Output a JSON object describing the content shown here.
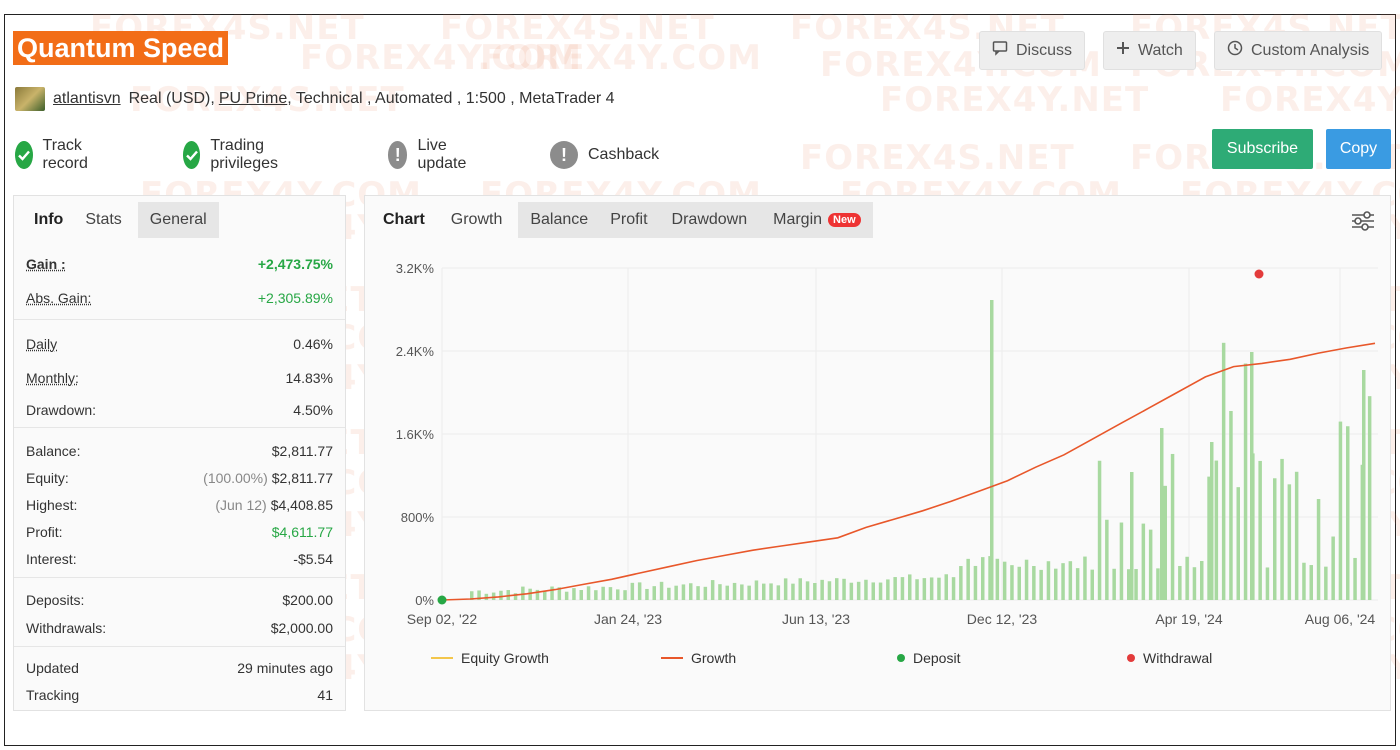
{
  "header": {
    "title": "Quantum Speed",
    "buttons": [
      {
        "label": "Discuss",
        "icon": "chat-icon"
      },
      {
        "label": "Watch",
        "icon": "plus-icon"
      },
      {
        "label": "Custom Analysis",
        "icon": "clock-icon"
      }
    ]
  },
  "meta": {
    "user": "atlantisvn",
    "account_type": "Real (USD),",
    "broker": "PU Prime",
    "details": ", Technical , Automated , 1:500 , MetaTrader 4"
  },
  "badges": [
    {
      "label": "Track record",
      "status": "ok"
    },
    {
      "label": "Trading privileges",
      "status": "ok"
    },
    {
      "label": "Live update",
      "status": "warn"
    },
    {
      "label": "Cashback",
      "status": "warn"
    }
  ],
  "actions": {
    "subscribe": "Subscribe",
    "copy": "Copy"
  },
  "left_tabs": [
    "Info",
    "Stats",
    "General"
  ],
  "stats": {
    "gain_label": "Gain :",
    "gain": "+2,473.75%",
    "abs_gain_label": "Abs. Gain:",
    "abs_gain": "+2,305.89%",
    "daily_label": "Daily",
    "daily": "0.46%",
    "monthly_label": "Monthly:",
    "monthly": "14.83%",
    "drawdown_label": "Drawdown:",
    "drawdown": "4.50%",
    "balance_label": "Balance:",
    "balance": "$2,811.77",
    "equity_label": "Equity:",
    "equity_note": "(100.00%)",
    "equity": "$2,811.77",
    "highest_label": "Highest:",
    "highest_note": "(Jun 12)",
    "highest": "$4,408.85",
    "profit_label": "Profit:",
    "profit": "$4,611.77",
    "interest_label": "Interest:",
    "interest": "-$5.54",
    "deposits_label": "Deposits:",
    "deposits": "$200.00",
    "withdrawals_label": "Withdrawals:",
    "withdrawals": "$2,000.00",
    "updated_label": "Updated",
    "updated": "29 minutes ago",
    "tracking_label": "Tracking",
    "tracking": "41"
  },
  "chart_tabs": {
    "title": "Chart",
    "items": [
      "Growth",
      "Balance",
      "Profit",
      "Drawdown",
      "Margin"
    ],
    "new_badge": "New"
  },
  "watermarks": [
    "FOREX4S.NET",
    "FOREX4Y.COM",
    "FOREX4Y.NET"
  ],
  "colors": {
    "accent": "#f26d17",
    "green": "#27a745",
    "growth": "#e8572a",
    "equity": "#f3c64b",
    "bars": "#a8d9a0",
    "withdrawal": "#e33b3b"
  },
  "chart_data": {
    "type": "line",
    "y_ticks": [
      "0%",
      "800%",
      "1.6K%",
      "2.4K%",
      "3.2K%"
    ],
    "ylim": [
      0,
      3200
    ],
    "x_ticks": [
      "Sep 02, '22",
      "Jan 24, '23",
      "Jun 13, '23",
      "Dec 12, '23",
      "Apr 19, '24",
      "Aug 06, '24"
    ],
    "series": [
      {
        "name": "Equity Growth",
        "values": []
      },
      {
        "name": "Growth",
        "values": [
          0,
          10,
          30,
          60,
          100,
          150,
          200,
          260,
          320,
          380,
          430,
          480,
          520,
          560,
          600,
          700,
          780,
          860,
          950,
          1050,
          1150,
          1280,
          1400,
          1550,
          1700,
          1850,
          2000,
          2150,
          2250,
          2280,
          2320,
          2380,
          2430,
          2474
        ]
      },
      {
        "name": "Deposit",
        "points": [
          {
            "x": "Sep 02, '22",
            "y": 0
          }
        ]
      },
      {
        "name": "Withdrawal",
        "points": [
          {
            "x": "Jun 12, '24",
            "y": 3200
          }
        ]
      }
    ],
    "legend": [
      "Equity Growth",
      "Growth",
      "Deposit",
      "Withdrawal"
    ]
  }
}
